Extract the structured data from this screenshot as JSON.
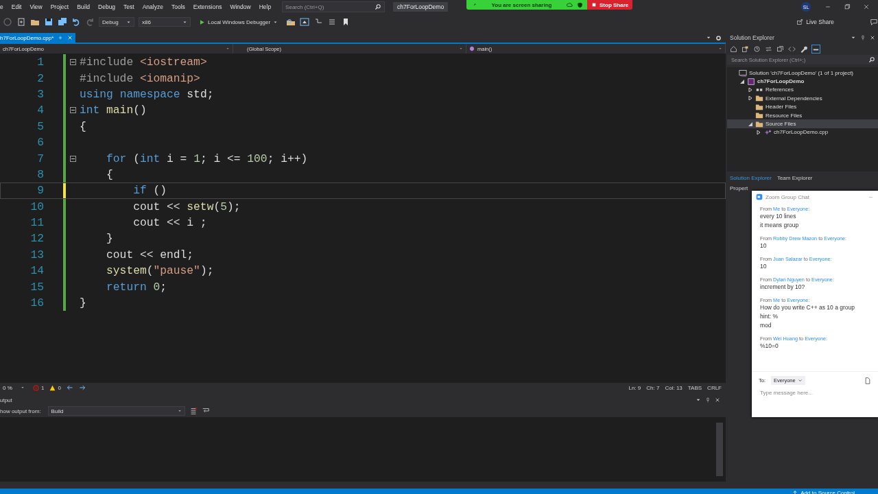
{
  "menu": [
    "e",
    "Edit",
    "View",
    "Project",
    "Build",
    "Debug",
    "Test",
    "Analyze",
    "Tools",
    "Extensions",
    "Window",
    "Help"
  ],
  "search": {
    "placeholder": "Search (Ctrl+Q)"
  },
  "window": {
    "title": "ch7ForLoopDemo",
    "account": "SL"
  },
  "share_banner": {
    "status": "You are screen sharing",
    "stop": "Stop Share"
  },
  "toolbar": {
    "configuration": "Debug",
    "platform": "x86",
    "run": "Local Windows Debugger",
    "live_share": "Live Share"
  },
  "editor_tabs": [
    {
      "label": "h7ForLoopDemo.cpp*",
      "selected": true
    }
  ],
  "navigation": {
    "project": "ch7ForLoopDemo",
    "scope": "(Global Scope)",
    "member": "main()"
  },
  "code_lines": [
    {
      "number": "1",
      "current": false,
      "fold": true,
      "saved": true,
      "tokens": [
        {
          "text": "#include",
          "kind": "preproc"
        },
        {
          "text": " <iostream>",
          "kind": "string"
        }
      ]
    },
    {
      "number": "2",
      "current": false,
      "fold": false,
      "saved": true,
      "tokens": [
        {
          "text": "#include",
          "kind": "preproc"
        },
        {
          "text": " <iomanip>",
          "kind": "string"
        }
      ]
    },
    {
      "number": "3",
      "current": false,
      "fold": false,
      "saved": true,
      "tokens": [
        {
          "text": "using",
          "kind": "keyword"
        },
        {
          "text": " namespace",
          "kind": "keyword"
        },
        {
          "text": " std;",
          "kind": "plain"
        }
      ]
    },
    {
      "number": "4",
      "current": false,
      "fold": true,
      "saved": true,
      "tokens": [
        {
          "text": "int",
          "kind": "keyword"
        },
        {
          "text": " main",
          "kind": "function"
        },
        {
          "text": "()",
          "kind": "plain"
        }
      ]
    },
    {
      "number": "5",
      "current": false,
      "fold": false,
      "saved": true,
      "tokens": [
        {
          "text": "{",
          "kind": "plain"
        }
      ]
    },
    {
      "number": "6",
      "current": false,
      "fold": false,
      "saved": true
    },
    {
      "number": "7",
      "current": false,
      "fold": true,
      "saved": true,
      "tokens": [
        {
          "text": "    for",
          "kind": "keyword"
        },
        {
          "text": " (",
          "kind": "plain"
        },
        {
          "text": "int",
          "kind": "keyword"
        },
        {
          "text": " i = ",
          "kind": "plain"
        },
        {
          "text": "1",
          "kind": "number"
        },
        {
          "text": "; i <= ",
          "kind": "plain"
        },
        {
          "text": "100",
          "kind": "number"
        },
        {
          "text": "; i++)",
          "kind": "plain"
        }
      ]
    },
    {
      "number": "8",
      "current": false,
      "fold": false,
      "saved": true,
      "tokens": [
        {
          "text": "    {",
          "kind": "plain"
        }
      ]
    },
    {
      "number": "9",
      "current": true,
      "fold": false,
      "saved": false,
      "tokens": [
        {
          "text": "        if",
          "kind": "keyword"
        },
        {
          "text": " ()",
          "kind": "plain"
        }
      ]
    },
    {
      "number": "10",
      "current": false,
      "fold": false,
      "saved": true,
      "tokens": [
        {
          "text": "        cout << ",
          "kind": "plain"
        },
        {
          "text": "setw",
          "kind": "function"
        },
        {
          "text": "(",
          "kind": "plain"
        },
        {
          "text": "5",
          "kind": "number"
        },
        {
          "text": ");",
          "kind": "plain"
        }
      ]
    },
    {
      "number": "11",
      "current": false,
      "fold": false,
      "saved": true,
      "tokens": [
        {
          "text": "        cout << i ;",
          "kind": "plain"
        }
      ]
    },
    {
      "number": "12",
      "current": false,
      "fold": false,
      "saved": true,
      "tokens": [
        {
          "text": "    }",
          "kind": "plain"
        }
      ]
    },
    {
      "number": "13",
      "current": false,
      "fold": false,
      "saved": true,
      "tokens": [
        {
          "text": "    cout << endl;",
          "kind": "plain"
        }
      ]
    },
    {
      "number": "14",
      "current": false,
      "fold": false,
      "saved": true,
      "tokens": [
        {
          "text": "    system",
          "kind": "function"
        },
        {
          "text": "(",
          "kind": "plain"
        },
        {
          "text": "\"pause\"",
          "kind": "string"
        },
        {
          "text": ");",
          "kind": "plain"
        }
      ]
    },
    {
      "number": "15",
      "current": false,
      "fold": false,
      "saved": true,
      "tokens": [
        {
          "text": "    return",
          "kind": "keyword"
        },
        {
          "text": " 0",
          "kind": "number"
        },
        {
          "text": ";",
          "kind": "plain"
        }
      ]
    },
    {
      "number": "16",
      "current": false,
      "fold": false,
      "saved": true,
      "tokens": [
        {
          "text": "}",
          "kind": "plain"
        }
      ]
    }
  ],
  "editor_status": {
    "zoom": "0 %",
    "errors": "1",
    "warnings": "0",
    "line": "Ln: 9",
    "char": "Ch: 7",
    "column": "Col: 13",
    "indent": "TABS",
    "line_ending": "CRLF"
  },
  "output": {
    "title": "utput",
    "source_label": "how output from:",
    "source": "Build"
  },
  "solution_explorer": {
    "title": "Solution Explorer",
    "search": {
      "placeholder": "Search Solution Explorer (Ctrl+;)"
    },
    "tree": [
      {
        "label": "Solution 'ch7ForLoopDemo' (1 of 1 project)",
        "kind": "solution",
        "selected": false,
        "children": [
          {
            "label": "ch7ForLoopDemo",
            "kind": "project",
            "expanded": true,
            "selected": false,
            "children": [
              {
                "label": "References",
                "kind": "references",
                "expanded": false,
                "selected": false
              },
              {
                "label": "External Dependencies",
                "kind": "folder",
                "expanded": false,
                "selected": false
              },
              {
                "label": "Header Files",
                "kind": "folder",
                "selected": false
              },
              {
                "label": "Resource Files",
                "kind": "folder",
                "selected": false
              },
              {
                "label": "Source Files",
                "kind": "folder",
                "expanded": true,
                "selected": true,
                "children": [
                  {
                    "label": "ch7ForLoopDemo.cpp",
                    "kind": "file",
                    "expanded": false,
                    "selected": false
                  }
                ]
              }
            ]
          }
        ]
      }
    ],
    "tabs": [
      {
        "label": "Solution Explorer",
        "selected": true
      },
      {
        "label": "Team Explorer",
        "selected": false
      }
    ],
    "properties_title": "Propert"
  },
  "chat": {
    "title": "Zoom Group Chat",
    "messages": [
      {
        "from_word": "From",
        "sender": "Me",
        "to_word": "to",
        "recipient": "Everyone:",
        "lines": [
          "every 10 lines",
          "it means group"
        ]
      },
      {
        "from_word": "From",
        "sender": "Robby Drew Mazon",
        "to_word": "to",
        "recipient": "Everyone:",
        "lines": [
          "10"
        ]
      },
      {
        "from_word": "From",
        "sender": "Juan Salazar",
        "to_word": "to",
        "recipient": "Everyone:",
        "lines": [
          "10"
        ]
      },
      {
        "from_word": "From",
        "sender": "Dylan Nguyen",
        "to_word": "to",
        "recipient": "Everyone:",
        "lines": [
          "increment by 10?"
        ]
      },
      {
        "from_word": "From",
        "sender": "Me",
        "to_word": "to",
        "recipient": "Everyone:",
        "lines": [
          "How do you write C++ as 10 a group",
          "hint: %",
          "mod"
        ]
      },
      {
        "from_word": "From",
        "sender": "Wei Huang",
        "to_word": "to",
        "recipient": "Everyone:",
        "lines": [
          "%10=0"
        ]
      }
    ],
    "to_label": "To:",
    "to_value": "Everyone",
    "input": {
      "placeholder": "Type message here..."
    }
  },
  "status_bar": {
    "source_control": "Add to Source Control"
  }
}
